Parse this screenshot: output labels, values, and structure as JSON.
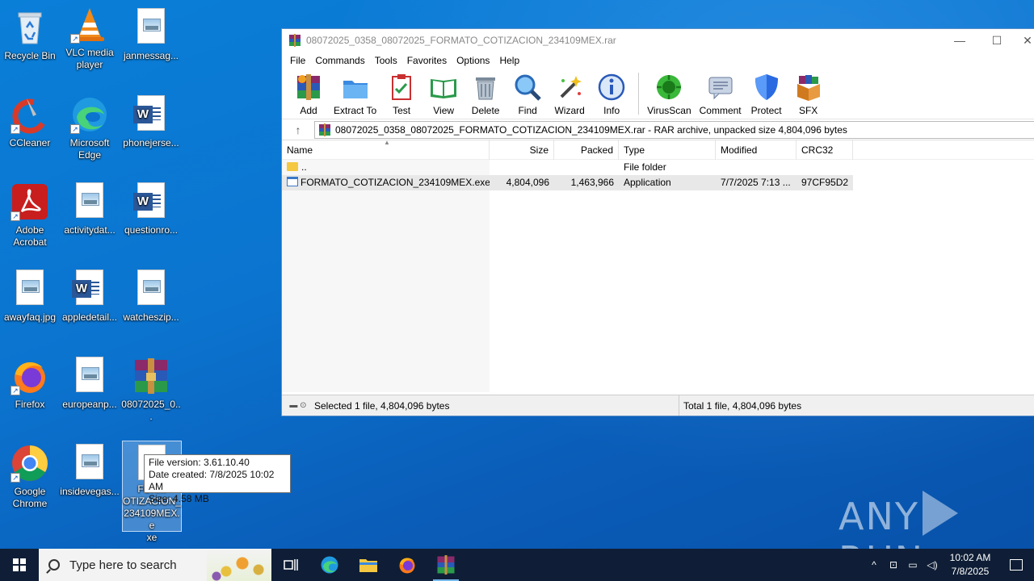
{
  "desktop": {
    "icons": [
      {
        "label": "Recycle Bin"
      },
      {
        "label": "VLC media player"
      },
      {
        "label": "janmessag..."
      },
      {
        "label": "CCleaner"
      },
      {
        "label": "Microsoft Edge"
      },
      {
        "label": "phonejerse..."
      },
      {
        "label": "Adobe Acrobat"
      },
      {
        "label": "activitydat..."
      },
      {
        "label": "questionro..."
      },
      {
        "label": "awayfaq.jpg"
      },
      {
        "label": "appledetail..."
      },
      {
        "label": "watcheszip..."
      },
      {
        "label": "Firefox"
      },
      {
        "label": "europeanp..."
      },
      {
        "label": "08072025_0..."
      },
      {
        "label": "Google Chrome"
      },
      {
        "label": "insidevegas..."
      },
      {
        "label": "FORMATO_COTIZACION_234109MEX.exe",
        "display": "FORM\nOTIZACION_\n234109MEX.e\nxe"
      }
    ],
    "tooltip": {
      "line1": "File version: 3.61.10.40",
      "line2": "Date created: 7/8/2025 10:02 AM",
      "line3": "Size: 4.58 MB"
    },
    "watermark": {
      "left": "ANY",
      "right": "RUN"
    }
  },
  "window": {
    "title": "08072025_0358_08072025_FORMATO_COTIZACION_234109MEX.rar",
    "controls": {
      "minimize": "—",
      "maximize": "☐",
      "close": "✕"
    },
    "menu": [
      "File",
      "Commands",
      "Tools",
      "Favorites",
      "Options",
      "Help"
    ],
    "toolbar": [
      "Add",
      "Extract To",
      "Test",
      "View",
      "Delete",
      "Find",
      "Wizard",
      "Info",
      "VirusScan",
      "Comment",
      "Protect",
      "SFX"
    ],
    "address": "08072025_0358_08072025_FORMATO_COTIZACION_234109MEX.rar - RAR archive, unpacked size 4,804,096 bytes",
    "columns": {
      "name": "Name",
      "size": "Size",
      "packed": "Packed",
      "type": "Type",
      "modified": "Modified",
      "crc": "CRC32"
    },
    "rows": [
      {
        "name": "..",
        "size": "",
        "packed": "",
        "type": "File folder",
        "modified": "",
        "crc": ""
      },
      {
        "name": "FORMATO_COTIZACION_234109MEX.exe",
        "size": "4,804,096",
        "packed": "1,463,966",
        "type": "Application",
        "modified": "7/7/2025 7:13 ...",
        "crc": "97CF95D2"
      }
    ],
    "status": {
      "left": "Selected 1 file, 4,804,096 bytes",
      "right": "Total 1 file, 4,804,096 bytes"
    }
  },
  "taskbar": {
    "search_placeholder": "Type here to search",
    "time": "10:02 AM",
    "date": "7/8/2025"
  },
  "colors": {
    "desktop": "#0b74cf",
    "taskbar": "#0f1e36",
    "accent": "#76b9ed"
  }
}
